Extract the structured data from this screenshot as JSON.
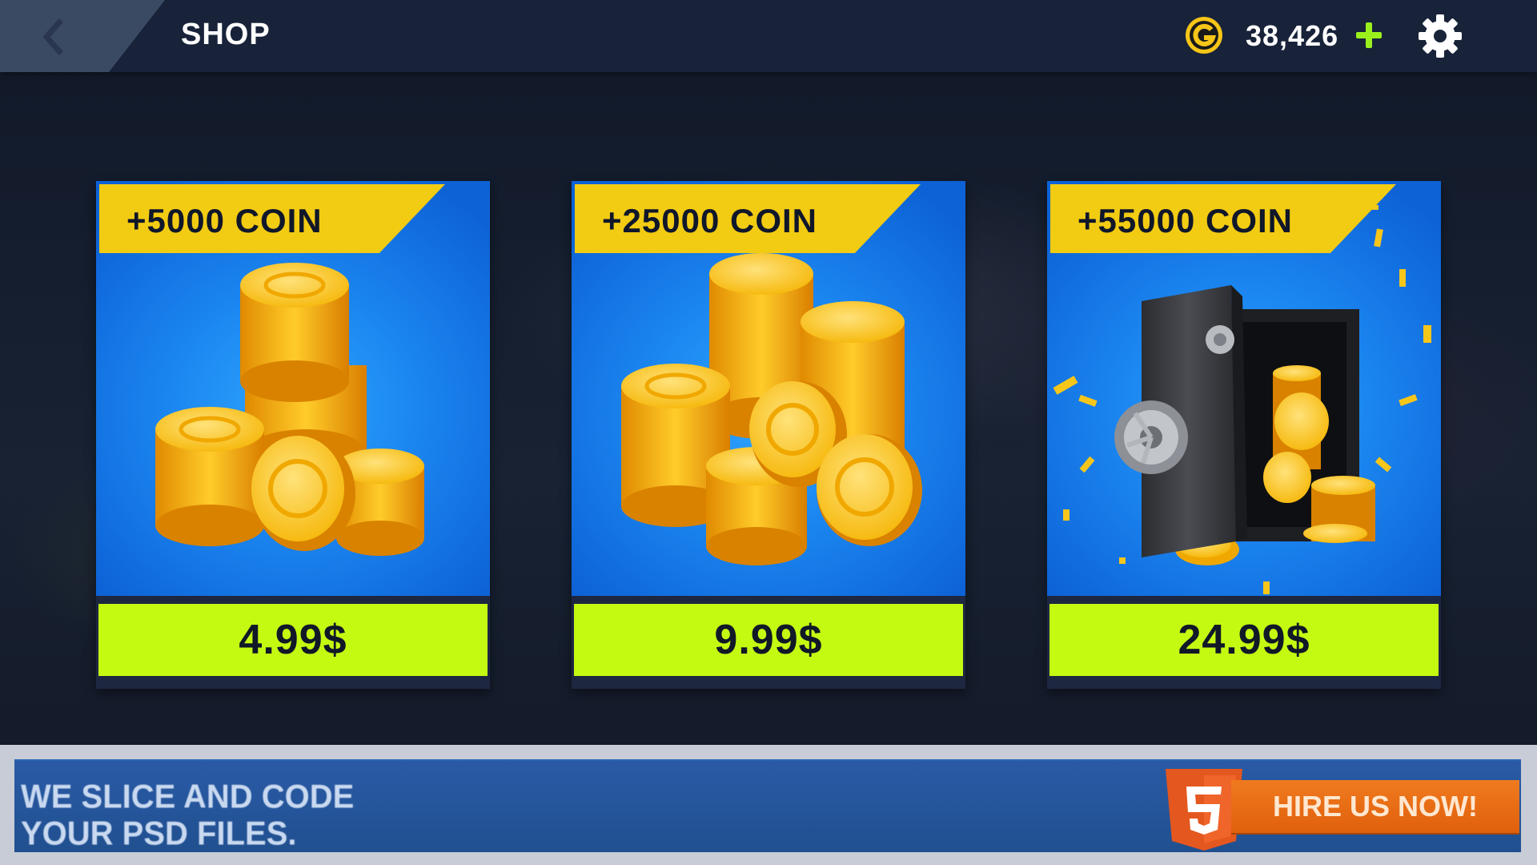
{
  "header": {
    "back_icon": "chevron-left-icon",
    "title": "SHOP",
    "currency_icon": "gold-coin-icon",
    "coin_balance": "38,426",
    "add_icon": "plus-icon",
    "settings_icon": "gear-icon"
  },
  "offers": [
    {
      "label": "+5000 COIN",
      "price": "4.99$",
      "illustration": "coin-pile-small"
    },
    {
      "label": "+25000 COIN",
      "price": "9.99$",
      "illustration": "coin-pile-large"
    },
    {
      "label": "+55000 COIN",
      "price": "24.99$",
      "illustration": "safe-with-coins"
    }
  ],
  "ad_banner": {
    "line1": "WE SLICE AND CODE",
    "line2": "YOUR PSD FILES.",
    "logo_icon": "html5-shield-icon",
    "button_label": "HIRE US NOW!"
  },
  "colors": {
    "topbar": "#18233a",
    "ribbon": "#f2cb13",
    "price_button": "#c4fa12",
    "card_blue": "#1b86f0",
    "accent_plus": "#9bf01c"
  }
}
